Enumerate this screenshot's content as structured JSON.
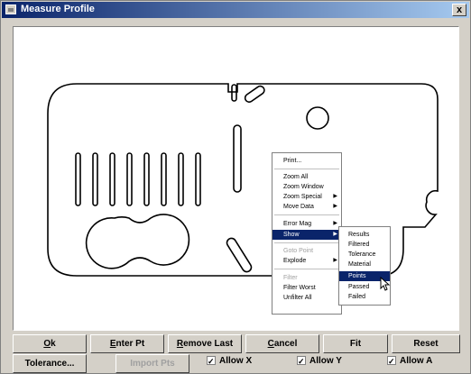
{
  "window": {
    "title": "Measure Profile",
    "close_glyph": "x"
  },
  "menu": {
    "items": [
      {
        "label": "Print...",
        "arrow": false,
        "state": "normal"
      },
      {
        "label": "Zoom All",
        "arrow": false,
        "state": "normal"
      },
      {
        "label": "Zoom Window",
        "arrow": false,
        "state": "normal"
      },
      {
        "label": "Zoom Special",
        "arrow": true,
        "state": "normal"
      },
      {
        "label": "Move Data",
        "arrow": true,
        "state": "normal"
      },
      {
        "label": "Error Mag",
        "arrow": true,
        "state": "normal"
      },
      {
        "label": "Show",
        "arrow": true,
        "state": "highlighted"
      },
      {
        "label": "Goto Point",
        "arrow": false,
        "state": "disabled"
      },
      {
        "label": "Explode",
        "arrow": true,
        "state": "normal"
      },
      {
        "label": "Filter",
        "arrow": false,
        "state": "disabled"
      },
      {
        "label": "Filter Worst",
        "arrow": false,
        "state": "normal"
      },
      {
        "label": "Unfilter All",
        "arrow": false,
        "state": "normal"
      }
    ]
  },
  "submenu": {
    "items": [
      {
        "label": "Results",
        "state": "normal"
      },
      {
        "label": "Filtered",
        "state": "normal"
      },
      {
        "label": "Tolerance",
        "state": "normal"
      },
      {
        "label": "Material",
        "state": "normal"
      },
      {
        "label": "Points",
        "state": "highlighted"
      },
      {
        "label": "Passed",
        "state": "normal"
      },
      {
        "label": "Failed",
        "state": "normal"
      }
    ]
  },
  "buttons_row1": {
    "ok": {
      "ul": "O",
      "rest": "k"
    },
    "enter_pt": {
      "ul": "E",
      "rest": "nter Pt"
    },
    "remove_last": {
      "ul": "R",
      "rest": "emove Last"
    },
    "cancel": {
      "ul": "C",
      "rest": "ancel"
    },
    "fit": "Fit",
    "reset": "Reset"
  },
  "buttons_row2": {
    "tolerance": "Tolerance...",
    "import_pts": "Import Pts",
    "allow_x": "Allow X",
    "allow_y": "Allow Y",
    "allow_a": "Allow A"
  },
  "checkbox_states": {
    "allow_x": true,
    "allow_y": true,
    "allow_a": true
  },
  "colors": {
    "title_start": "#0a246a",
    "title_end": "#a6caf0",
    "highlight": "#0a246a",
    "face": "#d4d0c8"
  }
}
